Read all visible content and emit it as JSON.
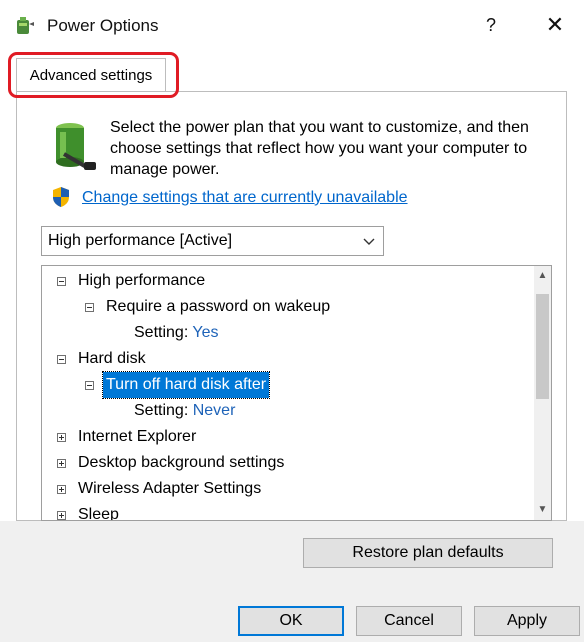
{
  "window": {
    "title": "Power Options",
    "help_label": "?",
    "close_label": "✕"
  },
  "tabs": [
    {
      "label": "Advanced settings",
      "active": true
    }
  ],
  "panel": {
    "description": "Select the power plan that you want to customize, and then choose settings that reflect how you want your computer to manage power.",
    "change_link": "Change settings that are currently unavailable",
    "plan_select": {
      "selected": "High performance [Active]"
    },
    "tree": [
      {
        "label": "High performance",
        "level": 0,
        "toggle": "minus"
      },
      {
        "label": "Require a password on wakeup",
        "level": 1,
        "toggle": "minus"
      },
      {
        "setting_label": "Setting:",
        "value": "Yes",
        "level": 2
      },
      {
        "label": "Hard disk",
        "level": 0,
        "toggle": "minus"
      },
      {
        "label": "Turn off hard disk after",
        "level": 1,
        "toggle": "minus",
        "selected": true
      },
      {
        "setting_label": "Setting:",
        "value": "Never",
        "level": 2
      },
      {
        "label": "Internet Explorer",
        "level": 0,
        "toggle": "plus"
      },
      {
        "label": "Desktop background settings",
        "level": 0,
        "toggle": "plus"
      },
      {
        "label": "Wireless Adapter Settings",
        "level": 0,
        "toggle": "plus"
      },
      {
        "label": "Sleep",
        "level": 0,
        "toggle": "plus"
      }
    ],
    "restore_button": "Restore plan defaults"
  },
  "buttons": {
    "ok": "OK",
    "cancel": "Cancel",
    "apply": "Apply"
  },
  "colors": {
    "accent": "#0078d7",
    "link": "#0066cc",
    "highlight_annotation": "#e01b24"
  }
}
